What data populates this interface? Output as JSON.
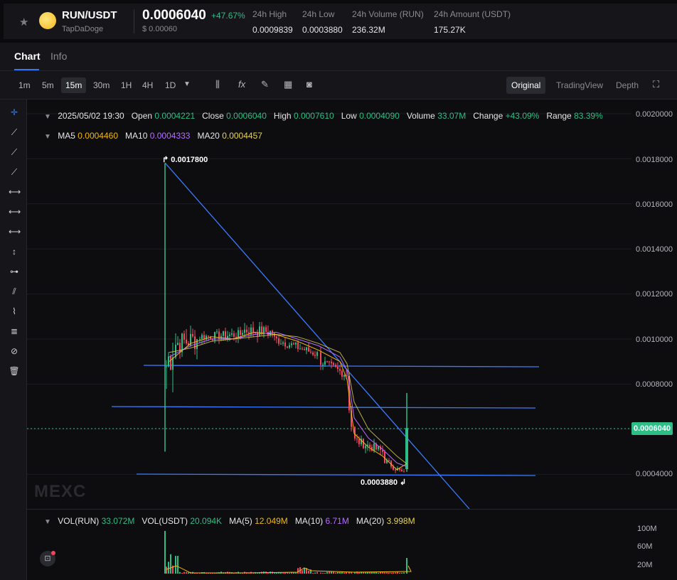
{
  "ticker": {
    "pair": "RUN/USDT",
    "name": "TapDaDoge",
    "price": "0.0006040",
    "change": "+47.67%",
    "usd_price": "$ 0.00060",
    "stats": [
      {
        "label": "24h High",
        "value": "0.0009839"
      },
      {
        "label": "24h Low",
        "value": "0.0003880"
      },
      {
        "label": "24h Volume (RUN)",
        "value": "236.32M"
      },
      {
        "label": "24h Amount (USDT)",
        "value": "175.27K"
      }
    ]
  },
  "tabs": {
    "chart": "Chart",
    "info": "Info"
  },
  "toolbar": {
    "timeframes": [
      "1m",
      "5m",
      "15m",
      "30m",
      "1H",
      "4H",
      "1D"
    ],
    "active_timeframe": "15m",
    "views": [
      "Original",
      "TradingView",
      "Depth"
    ],
    "active_view": "Original"
  },
  "legend": {
    "date": "2025/05/02 19:30",
    "open_label": "Open",
    "open": "0.0004221",
    "close_label": "Close",
    "close": "0.0006040",
    "high_label": "High",
    "high": "0.0007610",
    "low_label": "Low",
    "low": "0.0004090",
    "volume_label": "Volume",
    "volume": "33.07M",
    "change_label": "Change",
    "change": "+43.09%",
    "range_label": "Range",
    "range": "83.39%",
    "ma5_label": "MA5",
    "ma5": "0.0004460",
    "ma10_label": "MA10",
    "ma10": "0.0004333",
    "ma20_label": "MA20",
    "ma20": "0.0004457"
  },
  "vol_legend": {
    "vol_run_label": "VOL(RUN)",
    "vol_run": "33.072M",
    "vol_usdt_label": "VOL(USDT)",
    "vol_usdt": "20.094K",
    "ma5_label": "MA(5)",
    "ma5": "12.049M",
    "ma10_label": "MA(10)",
    "ma10": "6.71M",
    "ma20_label": "MA(20)",
    "ma20": "3.998M"
  },
  "price_axis": [
    "0.0020000",
    "0.0018000",
    "0.0016000",
    "0.0014000",
    "0.0012000",
    "0.0010000",
    "0.0008000",
    "0.0004000"
  ],
  "volume_axis": [
    "100M",
    "60M",
    "20M"
  ],
  "current_price_badge": "0.0006040",
  "annotations": {
    "high": "0.0017800",
    "low": "0.0003880"
  },
  "watermark": "MEXC",
  "colors": {
    "up": "#2ebd85",
    "down": "#f6465d",
    "accent": "#2d78ff",
    "ma5": "#f0b90b",
    "ma10": "#b66cff",
    "ma20": "#e8d44d"
  },
  "chart_data": {
    "type": "candlestick",
    "ylim": [
      0.0003,
      0.002
    ],
    "series": [
      {
        "name": "MA5",
        "values": [
          0.0009,
          0.00098,
          0.00101,
          0.001,
          0.00103,
          0.00102,
          0.00099,
          0.00095,
          0.0009,
          0.00082,
          0.00058,
          0.00052,
          0.00048,
          0.00042,
          0.000446
        ]
      },
      {
        "name": "MA10",
        "values": [
          0.00092,
          0.00097,
          0.001,
          0.001,
          0.00102,
          0.00103,
          0.001,
          0.00097,
          0.00092,
          0.00086,
          0.00065,
          0.00056,
          0.00051,
          0.00045,
          0.000433
        ]
      },
      {
        "name": "MA20",
        "values": [
          0.00094,
          0.00096,
          0.00099,
          0.001,
          0.00101,
          0.00102,
          0.00101,
          0.00098,
          0.00094,
          0.00089,
          0.00072,
          0.0006,
          0.00054,
          0.00048,
          0.0004457
        ]
      }
    ],
    "highlighted_candle": {
      "date": "2025/05/02 19:30",
      "open": 0.0004221,
      "close": 0.000604,
      "high": 0.000761,
      "low": 0.000409
    }
  }
}
